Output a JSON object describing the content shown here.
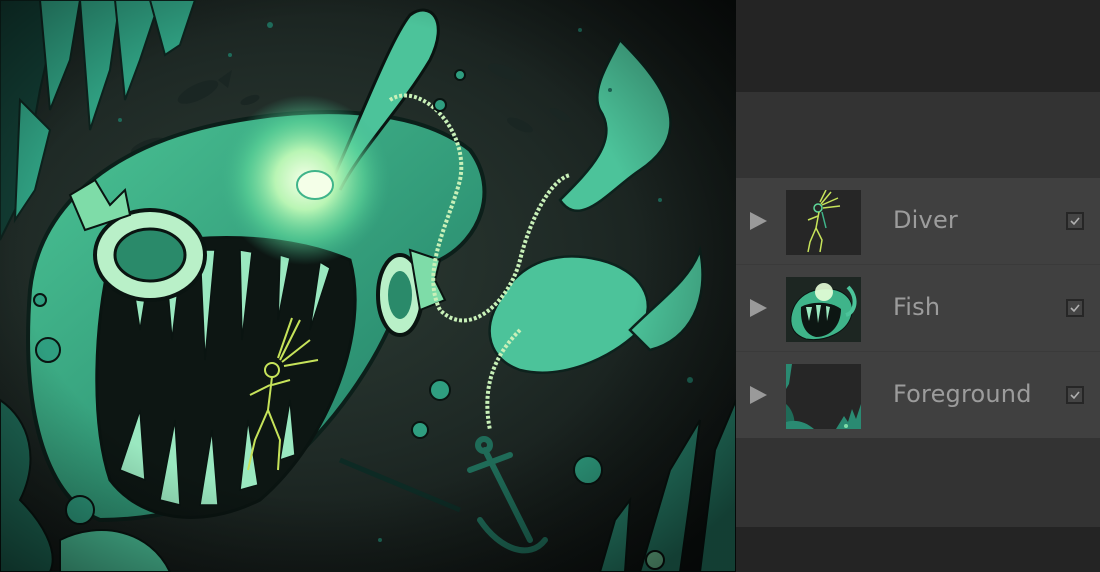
{
  "canvas": {
    "artwork": "anglerfish-diver-illustration",
    "palette": {
      "background": "#1f2a26",
      "fish_body": "#3fb48a",
      "fish_light": "#8ee8b5",
      "glow": "#e8ffd8",
      "dark_teal": "#0f3a33",
      "foreground_teal": "#2a8a72",
      "diver": "#c6e35a"
    }
  },
  "layers_panel": {
    "layers": [
      {
        "name": "Diver",
        "thumbnail": "diver-thumbnail",
        "visible": true
      },
      {
        "name": "Fish",
        "thumbnail": "fish-thumbnail",
        "visible": true
      },
      {
        "name": "Foreground",
        "thumbnail": "foreground-thumbnail",
        "visible": true
      }
    ],
    "colors": {
      "panel_dark": "#242424",
      "panel_mid": "#333333",
      "layer_row": "#404040",
      "text": "#9c9c9c",
      "arrow": "#9a9a9a"
    }
  }
}
